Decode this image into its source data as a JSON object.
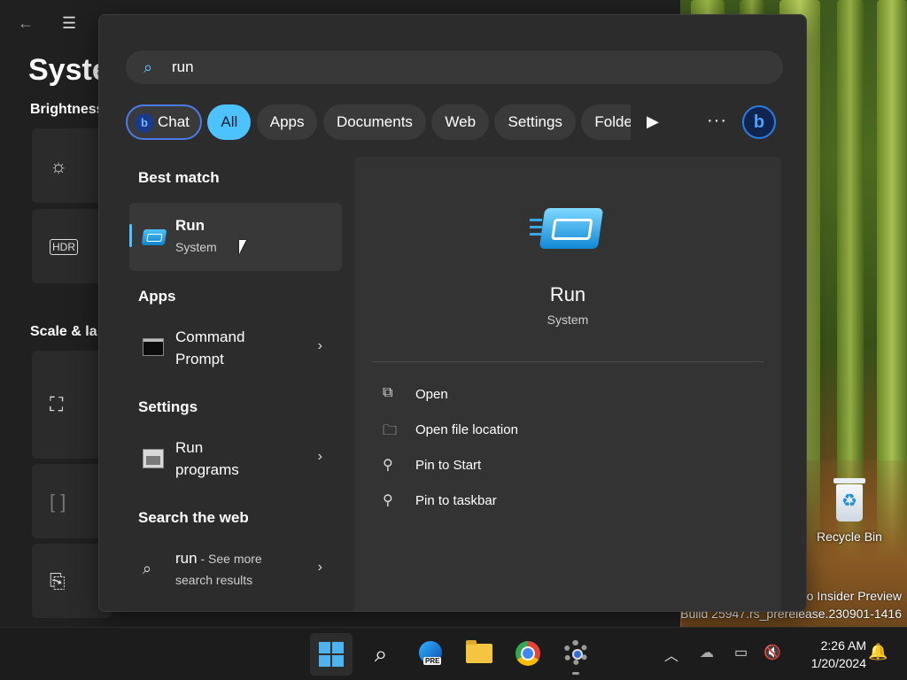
{
  "desktop": {
    "watermark_line1": "o Insider Preview",
    "watermark_line2": "Build 25947.rs_prerelease.230901-1416",
    "recycle_bin_label": "Recycle Bin"
  },
  "settings_window": {
    "title": "Syste",
    "sections": [
      "Brightness",
      "Scale & la"
    ]
  },
  "search": {
    "query": "run",
    "filters": [
      {
        "label": "Chat",
        "active": false
      },
      {
        "label": "All",
        "active": true
      },
      {
        "label": "Apps",
        "active": false
      },
      {
        "label": "Documents",
        "active": false
      },
      {
        "label": "Web",
        "active": false
      },
      {
        "label": "Settings",
        "active": false
      },
      {
        "label": "Folders",
        "active": false
      }
    ],
    "more_icon": "ellipsis-icon",
    "bing_label": "b"
  },
  "results": {
    "best_match_title": "Best match",
    "best_match": {
      "name": "Run",
      "sub": "System"
    },
    "apps_title": "Apps",
    "apps": [
      {
        "name_line1": "Command",
        "name_line2": "Prompt"
      }
    ],
    "settings_title": "Settings",
    "settings": [
      {
        "name_line1": "Run",
        "name_line2": "programs"
      }
    ],
    "web_title": "Search the web",
    "web": {
      "query": "run",
      "suffix": " - See more",
      "line2": "search results"
    }
  },
  "preview": {
    "name": "Run",
    "sub": "System",
    "actions": [
      {
        "label": "Open",
        "icon": "open-external-icon"
      },
      {
        "label": "Open file location",
        "icon": "folder-icon"
      },
      {
        "label": "Pin to Start",
        "icon": "pin-icon"
      },
      {
        "label": "Pin to taskbar",
        "icon": "pin-icon"
      }
    ]
  },
  "taskbar": {
    "time": "2:26 AM",
    "date": "1/20/2024",
    "edge_tag": "PRE"
  },
  "colors": {
    "accent": "#4cc2ff",
    "chat_border": "#4a7be8"
  }
}
